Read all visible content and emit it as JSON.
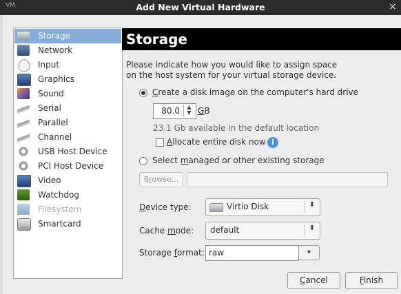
{
  "window": {
    "title": "Add New Virtual Hardware",
    "close_glyph": "×",
    "icon_label": "VM"
  },
  "sidebar": {
    "items": [
      {
        "label": "Storage",
        "icon": "harddisk-icon",
        "selected": true
      },
      {
        "label": "Network",
        "icon": "network-icon"
      },
      {
        "label": "Input",
        "icon": "mouse-icon"
      },
      {
        "label": "Graphics",
        "icon": "monitor-icon"
      },
      {
        "label": "Sound",
        "icon": "sound-icon"
      },
      {
        "label": "Serial",
        "icon": "serial-icon"
      },
      {
        "label": "Parallel",
        "icon": "parallel-icon"
      },
      {
        "label": "Channel",
        "icon": "channel-icon"
      },
      {
        "label": "USB Host Device",
        "icon": "usb-icon"
      },
      {
        "label": "PCI Host Device",
        "icon": "pci-icon"
      },
      {
        "label": "Video",
        "icon": "video-icon"
      },
      {
        "label": "Watchdog",
        "icon": "watchdog-icon"
      },
      {
        "label": "Filesystem",
        "icon": "folder-icon",
        "disabled": true
      },
      {
        "label": "Smartcard",
        "icon": "smartcard-icon"
      }
    ]
  },
  "page": {
    "title": "Storage",
    "description_line1": "Please indicate how you would like to assign space",
    "description_line2": "on the host system for your virtual storage device."
  },
  "create_option": {
    "label_pre": "",
    "label_mnemonic": "C",
    "label_post": "reate a disk image on the computer's hard drive",
    "selected": true,
    "size_value": "80.0",
    "size_unit_mnemonic": "G",
    "size_unit_rest": "B",
    "available": "23.1 Gb available in the default location",
    "allocate_mnemonic": "A",
    "allocate_rest": "llocate entire disk now",
    "allocate_checked": false
  },
  "existing_option": {
    "label_pre": "Select ",
    "label_mnemonic": "m",
    "label_post": "anaged or other existing storage",
    "browse_mnemonic": "r",
    "browse_pre": "B",
    "browse_post": "owse...",
    "path_value": ""
  },
  "form": {
    "device_type_mnemonic": "D",
    "device_type_rest": "evice type:",
    "device_type_value": "Virtio Disk",
    "cache_mode_pre": "Cache ",
    "cache_mode_mnemonic": "m",
    "cache_mode_post": "ode:",
    "cache_mode_value": "default",
    "storage_format_pre": "Storage ",
    "storage_format_mnemonic": "f",
    "storage_format_post": "ormat:",
    "storage_format_value": "raw"
  },
  "buttons": {
    "cancel_mnemonic": "C",
    "cancel_rest": "ancel",
    "finish_mnemonic": "F",
    "finish_rest": "inish"
  },
  "colors": {
    "selection": "#86abd9",
    "header_bg": "#000000",
    "info": "#4a8fde"
  }
}
